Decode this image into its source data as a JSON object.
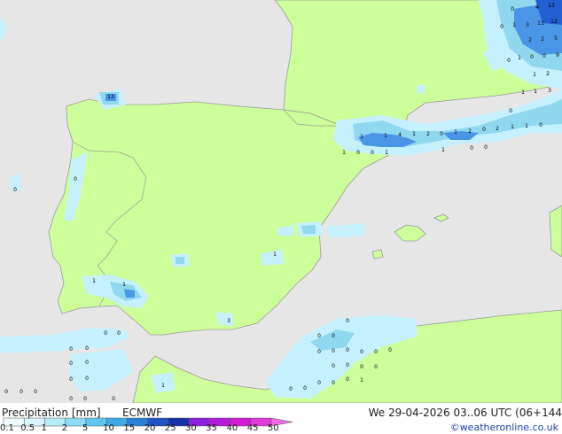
{
  "colors": {
    "sea": "#e6e6e6",
    "land": "#ccff99",
    "coast": "#9a9a9a",
    "precip_light": "#c5f0ff",
    "precip_mid": "#8fd8f0",
    "precip_heavy": "#4a96e6",
    "precip_very_heavy": "#2060d0"
  },
  "footer": {
    "title": "Precipitation [mm]",
    "model": "ECMWF",
    "datetime": "We 29-04-2026 03..06 UTC (06+144",
    "credit": "©weatheronline.co.uk"
  },
  "legend": {
    "ticks": [
      "0.1",
      "0.5",
      "1",
      "2",
      "5",
      "10",
      "15",
      "20",
      "25",
      "30",
      "35",
      "40",
      "45",
      "50"
    ],
    "colors": [
      "#f0fbff",
      "#d8f4ff",
      "#b6ecfb",
      "#8edcf5",
      "#5ec6ef",
      "#3fa9e6",
      "#2c7fd9",
      "#1f55c6",
      "#1630a8",
      "#8a1fe0",
      "#b21ad8",
      "#d21bd2",
      "#e03ad8",
      "#f06ae6"
    ]
  },
  "map_labels": {
    "values": [
      "13",
      "1",
      "1",
      "4",
      "1",
      "2",
      "0",
      "1",
      "2",
      "0",
      "2",
      "1",
      "1",
      "0",
      "1",
      "0",
      "0",
      "1",
      "1",
      "0",
      "0",
      "1",
      "1",
      "1",
      "3",
      "1",
      "0",
      "4",
      "13",
      "0",
      "1",
      "3",
      "11",
      "12",
      "2",
      "2",
      "5",
      "1",
      "0",
      "0",
      "9",
      "0",
      "1",
      "2",
      "1",
      "1",
      "3",
      "0",
      "0",
      "0",
      "0",
      "0",
      "0",
      "0",
      "0",
      "0",
      "0",
      "0",
      "0",
      "0",
      "0",
      "0",
      "0",
      "0",
      "0",
      "0",
      "0",
      "0",
      "0",
      "0",
      "0",
      "0",
      "0",
      "0",
      "0",
      "0",
      "0",
      "0",
      "1",
      "0",
      "0",
      "0",
      "0"
    ]
  }
}
